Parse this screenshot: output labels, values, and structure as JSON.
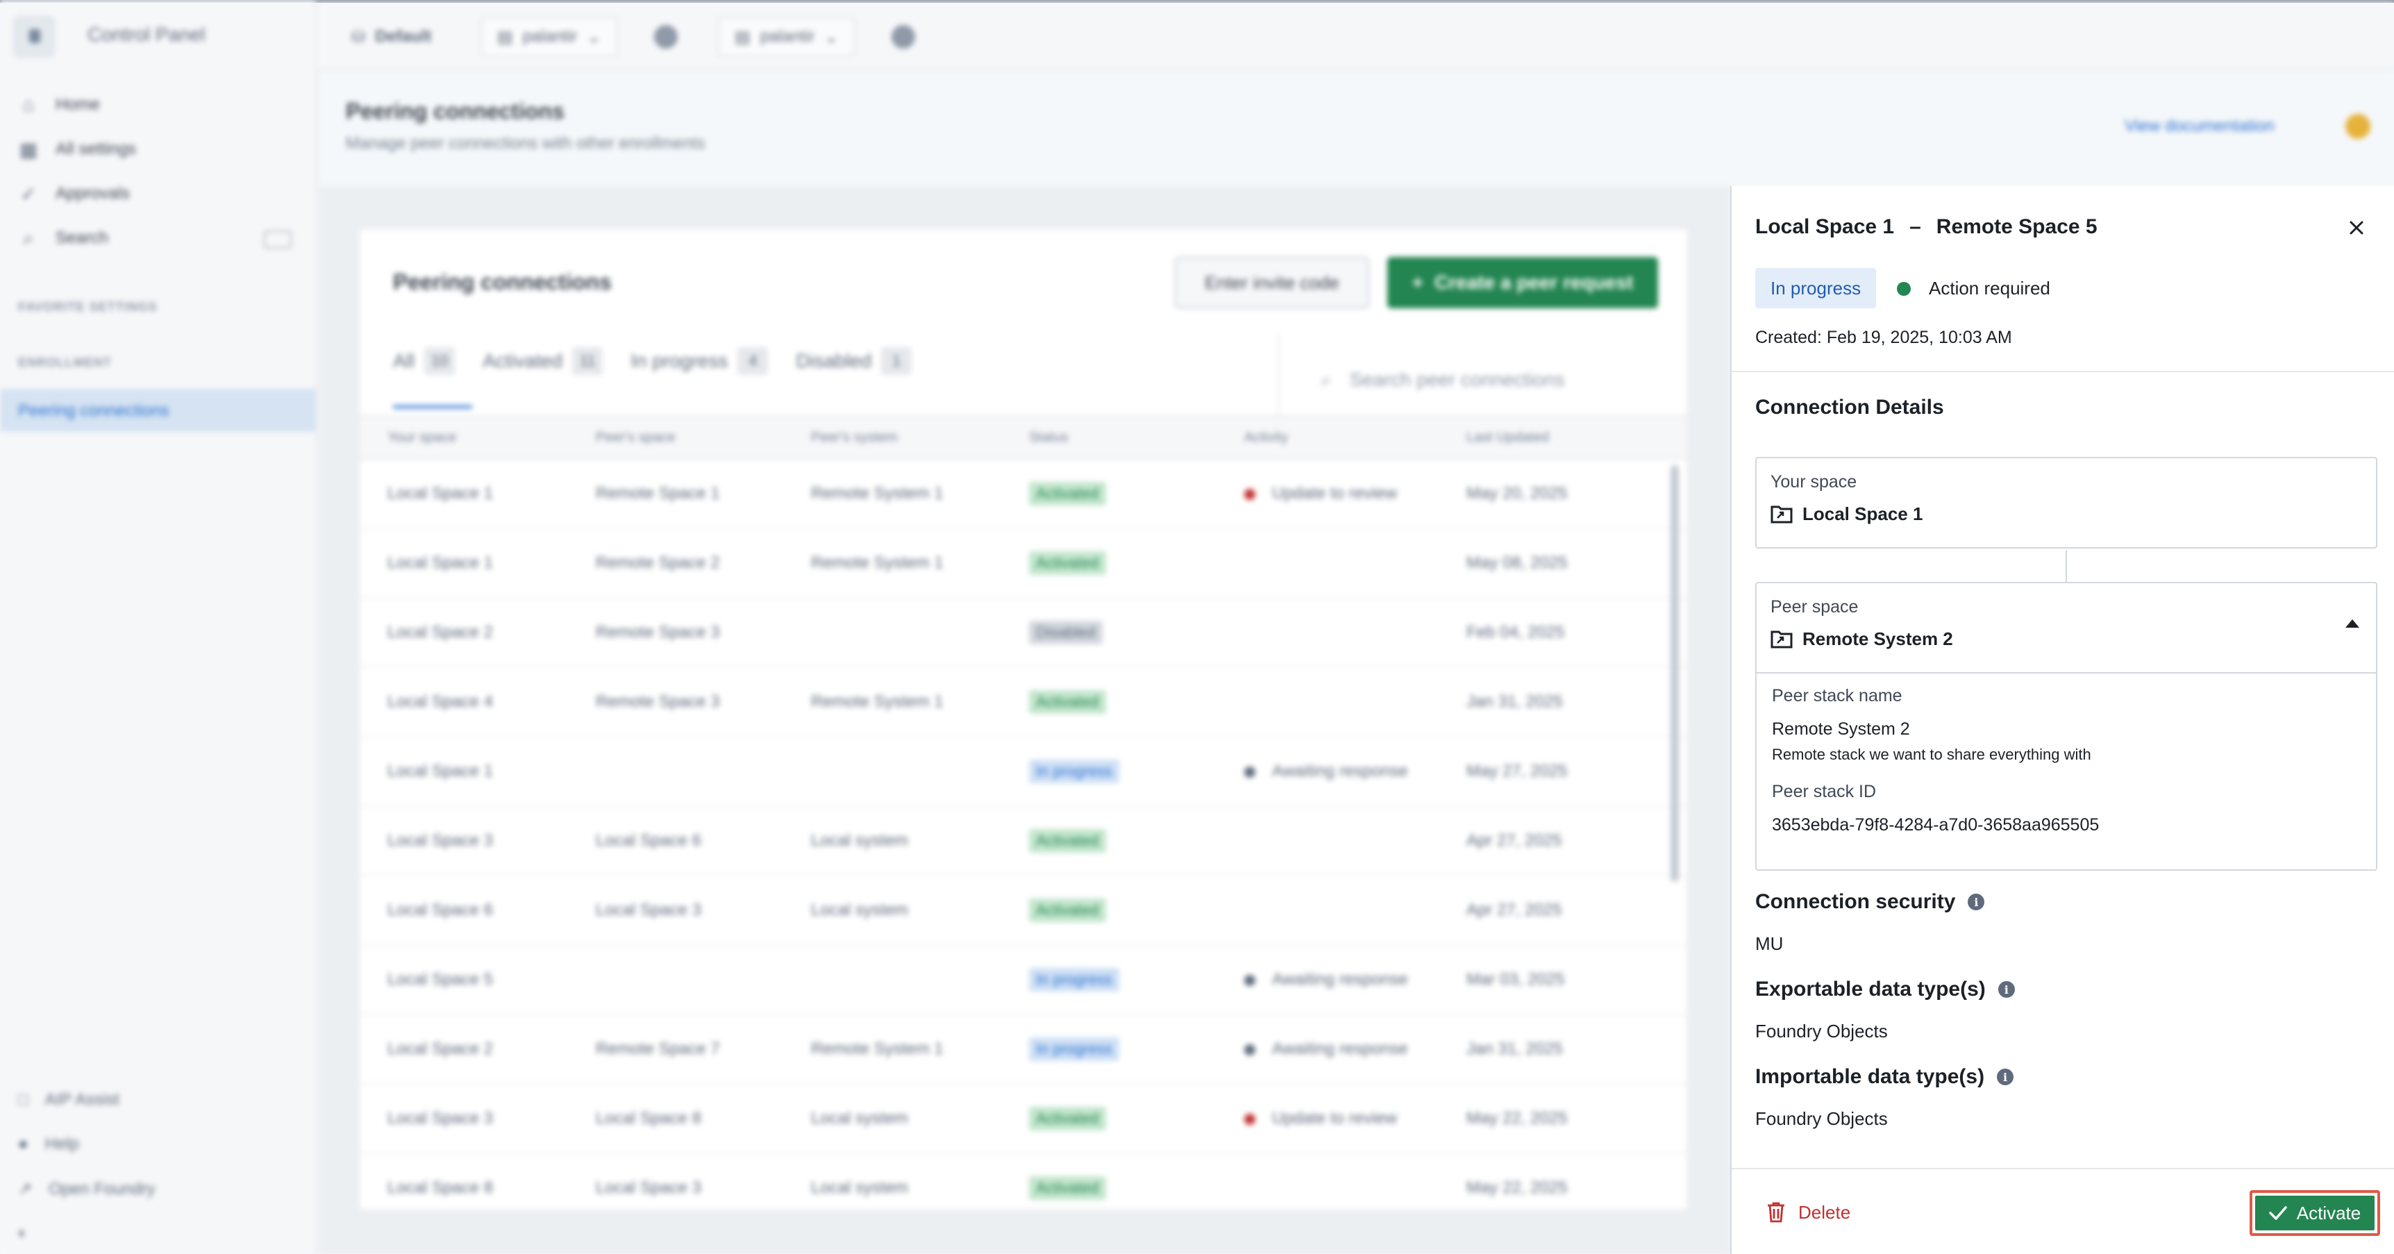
{
  "app": {
    "title": "Control Panel"
  },
  "topbar": {
    "workspace": "Default",
    "org_selector_1": "palantir",
    "org_selector_2": "palantir"
  },
  "sidebar": {
    "items": [
      {
        "label": "Home",
        "icon": "home-icon"
      },
      {
        "label": "All settings",
        "icon": "grid-icon"
      },
      {
        "label": "Approvals",
        "icon": "check-icon"
      },
      {
        "label": "Search",
        "icon": "search-icon"
      }
    ],
    "section_favorites": "FAVORITE SETTINGS",
    "section_enrollment": "ENROLLMENT",
    "active_item": "Peering connections",
    "bottom_items": [
      {
        "label": "AIP Assist",
        "icon": "aip-icon"
      },
      {
        "label": "Help",
        "icon": "help-icon"
      },
      {
        "label": "Open Foundry",
        "icon": "open-icon"
      }
    ]
  },
  "page": {
    "title": "Peering connections",
    "subtitle": "Manage peer connections with other enrollments",
    "doc_link": "View documentation"
  },
  "card": {
    "title": "Peering connections",
    "invite_button": "Enter invite code",
    "create_button": "Create a peer request",
    "tabs": [
      {
        "label": "All",
        "count": "10"
      },
      {
        "label": "Activated",
        "count": "11"
      },
      {
        "label": "In progress",
        "count": "4"
      },
      {
        "label": "Disabled",
        "count": "1"
      }
    ],
    "search_placeholder": "Search peer connections",
    "columns": [
      "Your space",
      "Peer's space",
      "Peer's system",
      "Status",
      "Activity",
      "Last Updated"
    ],
    "rows": [
      {
        "your": "Local Space 1",
        "peer": "Remote Space 1",
        "system": "Remote System 1",
        "status": "Activated",
        "activity": "Update to review",
        "updated": "May 20, 2025"
      },
      {
        "your": "Local Space 1",
        "peer": "Remote Space 2",
        "system": "Remote System 1",
        "status": "Activated",
        "activity": "",
        "updated": "May 08, 2025"
      },
      {
        "your": "Local Space 2",
        "peer": "Remote Space 3",
        "system": "",
        "status": "Disabled",
        "activity": "",
        "updated": "Feb 04, 2025"
      },
      {
        "your": "Local Space 4",
        "peer": "Remote Space 3",
        "system": "Remote System 1",
        "status": "Activated",
        "activity": "",
        "updated": "Jan 31, 2025"
      },
      {
        "your": "Local Space 1",
        "peer": "",
        "system": "",
        "status": "In progress",
        "activity": "Awaiting response",
        "updated": "May 27, 2025"
      },
      {
        "your": "Local Space 3",
        "peer": "Local Space 6",
        "system": "Local system",
        "status": "Activated",
        "activity": "",
        "updated": "Apr 27, 2025"
      },
      {
        "your": "Local Space 6",
        "peer": "Local Space 3",
        "system": "Local system",
        "status": "Activated",
        "activity": "",
        "updated": "Apr 27, 2025"
      },
      {
        "your": "Local Space 5",
        "peer": "",
        "system": "",
        "status": "In progress",
        "activity": "Awaiting response",
        "updated": "Mar 03, 2025"
      },
      {
        "your": "Local Space 2",
        "peer": "Remote Space 7",
        "system": "Remote System 1",
        "status": "In progress",
        "activity": "Awaiting response",
        "updated": "Jan 31, 2025"
      },
      {
        "your": "Local Space 3",
        "peer": "Local Space 8",
        "system": "Local system",
        "status": "Activated",
        "activity": "Update to review",
        "updated": "May 22, 2025"
      },
      {
        "your": "Local Space 8",
        "peer": "Local Space 3",
        "system": "Local system",
        "status": "Activated",
        "activity": "",
        "updated": "May 22, 2025"
      }
    ]
  },
  "panel": {
    "title_left": "Local Space 1",
    "title_sep": "–",
    "title_right": "Remote Space 5",
    "status_tag": "In progress",
    "action_required": "Action required",
    "created": "Created: Feb 19, 2025, 10:03 AM",
    "connection_details_heading": "Connection Details",
    "your_space_label": "Your space",
    "your_space_value": "Local Space 1",
    "peer_space_label": "Peer space",
    "peer_space_value": "Remote System 2",
    "peer_stack_name_label": "Peer stack name",
    "peer_stack_name_value": "Remote System 2",
    "peer_stack_description": "Remote stack we want to share everything with",
    "peer_stack_id_label": "Peer stack ID",
    "peer_stack_id_value": "3653ebda-79f8-4284-a7d0-3658aa965505",
    "connection_security_heading": "Connection security",
    "connection_security_value": "MU",
    "exportable_heading": "Exportable data type(s)",
    "exportable_value": "Foundry Objects",
    "importable_heading": "Importable data type(s)",
    "importable_value": "Foundry Objects",
    "delete_button": "Delete",
    "activate_button": "Activate"
  },
  "colors": {
    "accent_green": "#238551",
    "danger_red": "#c23030",
    "progress_blue": "#215db0",
    "highlight_border": "#e05a45"
  }
}
